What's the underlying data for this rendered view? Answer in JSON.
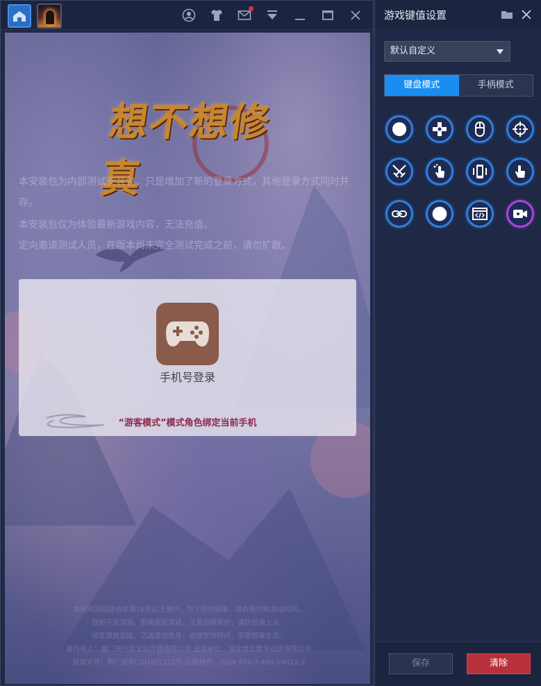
{
  "emulator": {
    "tabs": [
      {
        "name": "home",
        "icon": "home-icon"
      },
      {
        "name": "game",
        "icon": "game-thumbnail-icon"
      }
    ],
    "toolbar_icons": [
      "account-icon",
      "tshirt-icon",
      "mail-icon",
      "download-arrow-icon",
      "minimize-icon",
      "maximize-icon",
      "close-icon"
    ],
    "mail_badge_color": "#e0353a"
  },
  "game": {
    "logo_text": "想不想修真",
    "notice_lines": [
      "本安装包为内部测试安装包，只是增加了新的登录方式，其他登录方式同时并存。",
      "本安装包仅为体验最新游戏内容，无法充值。",
      "定向邀请测试人员，在版本尚未完全测试完成之前，请勿扩散。"
    ],
    "login": {
      "icon": "gamepad-icon",
      "label": "手机号登录",
      "guest_note": "“游客模式”模式角色绑定当前手机"
    },
    "footer_lines": [
      "本网络游戏适合年满18岁以上用户，为了您的健康，请合理控制游戏时间。",
      "抵制不良游戏，拒绝盗版游戏，注意自我保护，谨防受骗上当。",
      "适度游戏益脑，沉迷游戏伤身，合理安排时间，享受健康生活。",
      "著作权人：厦门市行走文化传播有限公司  出版单位：湖北盘古数字出版有限公司",
      "批准文号：新广出审[2018]1232号  出版物号：ISBN 978-7-498-04012-2"
    ]
  },
  "panel": {
    "title": "游戏键值设置",
    "header_icons": [
      "folder-icon",
      "close-icon"
    ],
    "profile": "默认自定义",
    "modes": [
      {
        "label": "键盘模式",
        "active": true
      },
      {
        "label": "手柄模式",
        "active": false
      }
    ],
    "keys": [
      {
        "name": "tap-key",
        "icon": "circle-icon"
      },
      {
        "name": "dpad-key",
        "icon": "dpad-icon"
      },
      {
        "name": "mouse-key",
        "icon": "mouse-icon"
      },
      {
        "name": "crosshair-key",
        "icon": "crosshair-icon"
      },
      {
        "name": "crossed-swords-key",
        "icon": "crossed-swords-icon"
      },
      {
        "name": "swipe-key",
        "icon": "swipe-hand-icon"
      },
      {
        "name": "shake-key",
        "icon": "phone-shake-icon"
      },
      {
        "name": "tap-hand-key",
        "icon": "tap-hand-icon"
      },
      {
        "name": "link-key",
        "icon": "link-icon"
      },
      {
        "name": "hold-key",
        "icon": "filled-circle-icon"
      },
      {
        "name": "script-key",
        "icon": "code-window-icon"
      },
      {
        "name": "camera-key",
        "icon": "video-camera-icon",
        "accent": "#b040e0"
      }
    ],
    "save_label": "保存",
    "clear_label": "清除",
    "accent_color": "#1a8ef0",
    "clear_color": "#b8303c"
  }
}
